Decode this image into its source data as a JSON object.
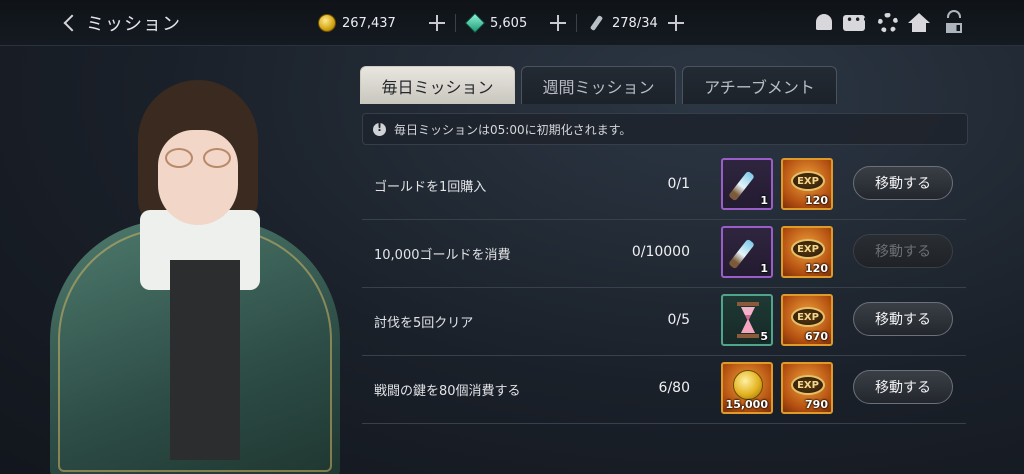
{
  "header": {
    "title": "ミッション",
    "gold": "267,437",
    "gems": "5,605",
    "stamina": "278/34"
  },
  "tabs": [
    {
      "label": "毎日ミッション",
      "active": true
    },
    {
      "label": "週間ミッション",
      "active": false
    },
    {
      "label": "アチーブメント",
      "active": false
    }
  ],
  "notice": "毎日ミッションは05:00に初期化されます。",
  "missions": [
    {
      "name": "ゴールドを1回購入",
      "progress": "0/1",
      "reward1": {
        "icon": "dagger-icon",
        "qty": "1"
      },
      "reward2": {
        "icon": "exp-icon",
        "label": "EXP",
        "qty": "120"
      },
      "button": "移動する",
      "enabled": true
    },
    {
      "name": "10,000ゴールドを消費",
      "progress": "0/10000",
      "reward1": {
        "icon": "dagger-icon",
        "qty": "1"
      },
      "reward2": {
        "icon": "exp-icon",
        "label": "EXP",
        "qty": "120"
      },
      "button": "移動する",
      "enabled": false
    },
    {
      "name": "討伐を5回クリア",
      "progress": "0/5",
      "reward1": {
        "icon": "hourglass-icon",
        "qty": "5"
      },
      "reward2": {
        "icon": "exp-icon",
        "label": "EXP",
        "qty": "670"
      },
      "button": "移動する",
      "enabled": true
    },
    {
      "name": "戦闘の鍵を80個消費する",
      "progress": "6/80",
      "reward1": {
        "icon": "gold-coin-icon",
        "qty": "15,000"
      },
      "reward2": {
        "icon": "exp-icon",
        "label": "EXP",
        "qty": "790"
      },
      "button": "移動する",
      "enabled": true
    }
  ],
  "colors": {
    "accent_tab": "#e8e6df",
    "exp_frame": "#e09a2a",
    "rare_frame": "#9b5ec9",
    "uncommon_frame": "#4fa58c"
  }
}
